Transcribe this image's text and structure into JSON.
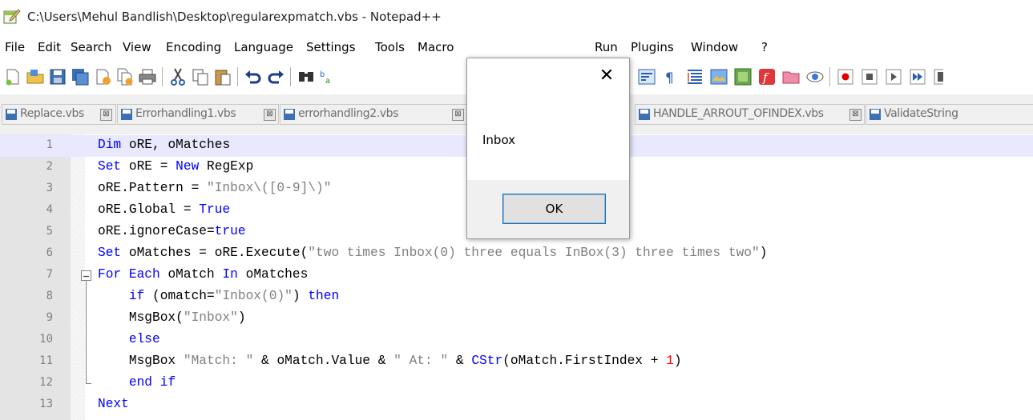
{
  "window": {
    "title": "C:\\Users\\Mehul Bandlish\\Desktop\\regularexpmatch.vbs - Notepad++",
    "app_icon": "notepad-plus-plus-icon"
  },
  "menu": [
    "File",
    "Edit",
    "Search",
    "View",
    "Encoding",
    "Language",
    "Settings",
    "Tools",
    "Macro",
    "Run",
    "Plugins",
    "Window",
    "?"
  ],
  "toolbar": {
    "icons": [
      "new-file-icon",
      "open-file-icon",
      "save-icon",
      "save-all-icon",
      "close-icon",
      "close-all-icon",
      "print-icon",
      "cut-icon",
      "copy-icon",
      "paste-icon",
      "undo-icon",
      "redo-icon",
      "find-icon",
      "replace-icon",
      "wrap-icon",
      "show-all-chars-icon",
      "indent-guide-icon",
      "doc-map-icon",
      "function-list-icon",
      "monitor-icon",
      "folder-workspace-icon",
      "eye-icon",
      "record-macro-icon",
      "stop-record-icon",
      "play-macro-icon",
      "run-macro-multiple-icon",
      "save-macro-icon"
    ]
  },
  "tabs": [
    {
      "label": "Replace.vbs",
      "close": "⊠"
    },
    {
      "label": "Errorhandling1.vbs",
      "close": "⊠"
    },
    {
      "label": "errorhandling2.vbs",
      "close": "⊠"
    },
    {
      "label": "HANDLE_ARROUT_OFINDEX.vbs",
      "close": "⊠"
    },
    {
      "label": "ValidateString",
      "close": ""
    }
  ],
  "editor": {
    "current_line": 1,
    "lines": [
      {
        "n": "1",
        "text": "Dim oRE, oMatches"
      },
      {
        "n": "2",
        "text": "Set oRE = New RegExp"
      },
      {
        "n": "3",
        "text": "oRE.Pattern = \"Inbox\\([0-9]\\)\""
      },
      {
        "n": "4",
        "text": "oRE.Global = True"
      },
      {
        "n": "5",
        "text": "oRE.ignoreCase=true"
      },
      {
        "n": "6",
        "text": "Set oMatches = oRE.Execute(\"two times Inbox(0) three equals InBox(3) three times two\")"
      },
      {
        "n": "7",
        "text": "For Each oMatch In oMatches"
      },
      {
        "n": "8",
        "text": "    if (omatch=\"Inbox(0)\") then"
      },
      {
        "n": "9",
        "text": "    MsgBox(\"Inbox\")"
      },
      {
        "n": "10",
        "text": "    else"
      },
      {
        "n": "11",
        "text": "    MsgBox \"Match: \" & oMatch.Value & \" At: \" & CStr(oMatch.FirstIndex + 1)"
      },
      {
        "n": "12",
        "text": "    end if"
      },
      {
        "n": "13",
        "text": "Next"
      }
    ]
  },
  "dialog": {
    "close": "✕",
    "message": "Inbox",
    "ok_label": "OK"
  }
}
